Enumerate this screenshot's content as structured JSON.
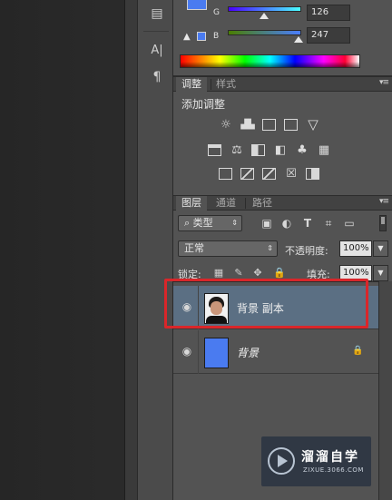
{
  "color_panel": {
    "channels": [
      {
        "label": "G",
        "value": "126",
        "level": 126,
        "gradient_start": "#4a00ff",
        "gradient_end": "#4affff"
      },
      {
        "label": "B",
        "value": "247",
        "level": 247,
        "gradient_start": "#4a7e00",
        "gradient_end": "#4a7eff"
      }
    ],
    "foreground_color": "#4a7bf0",
    "warning_icon": "gamut-warning-icon",
    "spectrum": "color-spectrum-bar"
  },
  "dock": {
    "icons": [
      {
        "name": "properties-icon",
        "glyph": "▤"
      },
      {
        "name": "character-icon",
        "glyph": "A|"
      },
      {
        "name": "paragraph-icon",
        "glyph": "¶"
      }
    ]
  },
  "adjustments_panel": {
    "tabs": [
      "调整",
      "样式"
    ],
    "active_tab": 0,
    "title": "添加调整",
    "rows": [
      [
        "brightness-contrast-icon",
        "levels-icon",
        "curves-icon",
        "exposure-icon",
        "gradient-triangle-icon"
      ],
      [
        "vibrance-icon",
        "hue-saturation-icon",
        "color-balance-icon",
        "black-white-icon",
        "photo-filter-icon",
        "channel-mixer-icon",
        "color-lookup-icon"
      ],
      [
        "invert-icon",
        "posterize-icon",
        "threshold-icon",
        "selective-color-icon",
        "gradient-map-icon"
      ]
    ]
  },
  "layers_panel": {
    "tabs": [
      "图层",
      "通道",
      "路径"
    ],
    "active_tab": 0,
    "filter": {
      "kind_label": "类型"
    },
    "blend_mode": "正常",
    "opacity_label": "不透明度:",
    "opacity_value": "100%",
    "lock_label": "锁定:",
    "fill_label": "填充:",
    "fill_value": "100%",
    "layers": [
      {
        "name": "背景 副本",
        "selected": true,
        "visible": true,
        "thumbnail": "portrait-photo",
        "locked": false
      },
      {
        "name": "背景",
        "selected": false,
        "visible": true,
        "thumbnail": "#4a7bf0",
        "locked": true
      }
    ]
  },
  "watermark": {
    "title": "溜溜自学",
    "subtitle": "ZIXUE.3066.COM"
  },
  "highlight_color": "#d9262a"
}
